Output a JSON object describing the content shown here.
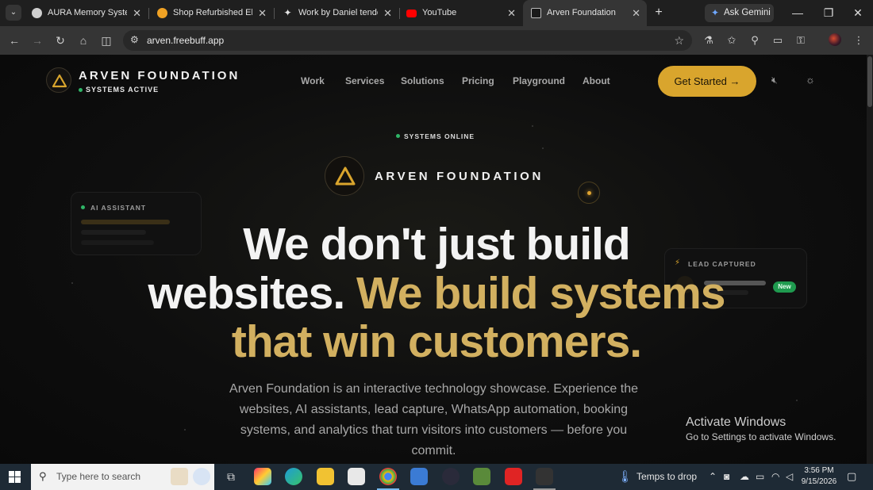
{
  "browser": {
    "tabs": [
      {
        "title": "AURA Memory System",
        "active": false
      },
      {
        "title": "Shop Refurbished EliteBook",
        "active": false
      },
      {
        "title": "Work by Daniel tendo",
        "active": false
      },
      {
        "title": "YouTube",
        "active": false
      },
      {
        "title": "Arven Foundation",
        "active": true
      }
    ],
    "ask_gemini": "Ask Gemini",
    "url": "arven.freebuff.app"
  },
  "site": {
    "brand_name": "ARVEN FOUNDATION",
    "brand_status": "SYSTEMS ACTIVE",
    "nav": [
      "Work",
      "Services",
      "Solutions",
      "Pricing",
      "Playground",
      "About"
    ],
    "cta_label": "Get Started",
    "cta_arrow": "→",
    "systems_online": "SYSTEMS ONLINE",
    "hero_brand": "ARVEN FOUNDATION",
    "ai_card_title": "AI ASSISTANT",
    "lead_card_title": "LEAD CAPTURED",
    "lead_badge": "New",
    "headline_line1": "We don't just build",
    "headline_line2_white": "websites.",
    "headline_line2_gold": "We build systems",
    "headline_line3_gold": "that win customers.",
    "description": "Arven Foundation is an interactive technology showcase. Experience the websites, AI assistants, lead capture, WhatsApp automation, booking systems, and analytics that turn visitors into customers — before you commit."
  },
  "os": {
    "activate_title": "Activate Windows",
    "activate_sub": "Go to Settings to activate Windows.",
    "search_placeholder": "Type here to search",
    "weather": "Temps to drop",
    "time": "3:56 PM",
    "date": "9/15/2026"
  },
  "colors": {
    "accent_gold": "#d9a52d",
    "headline_gold": "#d2b060",
    "status_green": "#2fb567"
  }
}
